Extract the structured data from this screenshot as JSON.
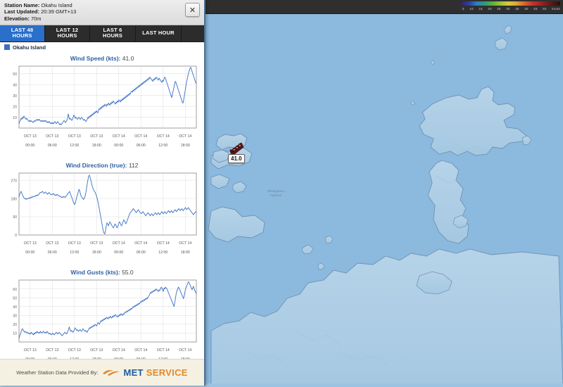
{
  "window": {
    "close_label": "✕"
  },
  "station": {
    "name_label": "Station Name:",
    "name_value": "Okahu Island",
    "updated_label": "Last Updated:",
    "updated_value": "20:39 GMT+13",
    "elevation_label": "Elevation:",
    "elevation_value": "70m"
  },
  "tabs": [
    {
      "label": "LAST 48 HOURS",
      "active": true
    },
    {
      "label": "LAST 12 HOURS",
      "active": false
    },
    {
      "label": "LAST 6 HOURS",
      "active": false
    },
    {
      "label": "LAST HOUR",
      "active": false
    }
  ],
  "legend": {
    "series_label": "Okahu Island",
    "series_color": "#3a6fc4"
  },
  "map": {
    "marker_value": "41.0",
    "marker_color": "#5e1414",
    "ocean_color": "#8cb9de",
    "land_color": "#aecee6",
    "scale_units": "knots",
    "scale_ticks": [
      "5",
      "10",
      "15",
      "20",
      "25",
      "30",
      "35",
      "40",
      "45",
      "50"
    ]
  },
  "footer": {
    "credit": "Weather Station Data Provided By:",
    "brand_first": "MET",
    "brand_second": "SERVICE",
    "brand_first_color": "#1c5c9e",
    "brand_second_color": "#e08a2e"
  },
  "chart_data": [
    {
      "type": "line",
      "title_main": "Wind Speed (kts):",
      "title_value": "41.0",
      "ylabel": "",
      "xlabel": "",
      "ylim": [
        0,
        57
      ],
      "yticks": [
        10,
        20,
        30,
        40,
        50
      ],
      "xticks": [
        {
          "date": "OCT 13",
          "time": "00:00"
        },
        {
          "date": "OCT 13",
          "time": "06:00"
        },
        {
          "date": "OCT 13",
          "time": "12:00"
        },
        {
          "date": "OCT 13",
          "time": "18:00"
        },
        {
          "date": "OCT 14",
          "time": "00:00"
        },
        {
          "date": "OCT 14",
          "time": "06:00"
        },
        {
          "date": "OCT 14",
          "time": "12:00"
        },
        {
          "date": "OCT 14",
          "time": "18:00"
        }
      ],
      "grid": true,
      "series_color": "#3a6fc4",
      "values": [
        4,
        6,
        7,
        9,
        8,
        10,
        9,
        11,
        10,
        9,
        8,
        9,
        8,
        7,
        6,
        7,
        6,
        7,
        6,
        6,
        5,
        6,
        7,
        6,
        7,
        8,
        7,
        8,
        7,
        8,
        7,
        6,
        7,
        6,
        7,
        6,
        7,
        6,
        7,
        6,
        5,
        6,
        5,
        6,
        5,
        4,
        5,
        4,
        5,
        4,
        5,
        6,
        5,
        4,
        5,
        6,
        5,
        4,
        3,
        4,
        3,
        4,
        5,
        6,
        7,
        6,
        5,
        6,
        7,
        9,
        13,
        10,
        8,
        9,
        8,
        7,
        8,
        10,
        12,
        11,
        9,
        10,
        9,
        8,
        9,
        10,
        9,
        8,
        9,
        10,
        9,
        8,
        7,
        8,
        7,
        6,
        7,
        8,
        10,
        9,
        11,
        10,
        12,
        11,
        13,
        12,
        14,
        13,
        15,
        14,
        16,
        15,
        14,
        16,
        18,
        17,
        19,
        18,
        20,
        19,
        21,
        20,
        22,
        21,
        20,
        22,
        21,
        23,
        22,
        21,
        23,
        22,
        24,
        23,
        25,
        24,
        23,
        22,
        24,
        23,
        25,
        24,
        26,
        25,
        24,
        26,
        25,
        27,
        26,
        28,
        27,
        29,
        28,
        30,
        29,
        31,
        30,
        32,
        31,
        33,
        34,
        33,
        35,
        34,
        36,
        35,
        37,
        36,
        38,
        37,
        39,
        38,
        40,
        39,
        41,
        40,
        42,
        41,
        43,
        42,
        44,
        43,
        45,
        44,
        46,
        45,
        47,
        46,
        45,
        44,
        43,
        45,
        44,
        46,
        45,
        47,
        46,
        45,
        44,
        46,
        45,
        44,
        43,
        42,
        44,
        43,
        45,
        47,
        46,
        44,
        42,
        40,
        38,
        36,
        34,
        32,
        30,
        28,
        31,
        34,
        37,
        40,
        43,
        42,
        40,
        38,
        36,
        34,
        32,
        30,
        28,
        26,
        24,
        23,
        26,
        30,
        34,
        38,
        42,
        45,
        48,
        51,
        53,
        55,
        56,
        54,
        52,
        50,
        48,
        46,
        44,
        42,
        41
      ]
    },
    {
      "type": "line",
      "title_main": "Wind Direction (true):",
      "title_value": "112",
      "ylabel": "",
      "xlabel": "",
      "ylim": [
        0,
        305
      ],
      "yticks": [
        0,
        90,
        180,
        270
      ],
      "xticks": [
        {
          "date": "OCT 13",
          "time": "00:00"
        },
        {
          "date": "OCT 13",
          "time": "06:00"
        },
        {
          "date": "OCT 13",
          "time": "12:00"
        },
        {
          "date": "OCT 13",
          "time": "18:00"
        },
        {
          "date": "OCT 14",
          "time": "00:00"
        },
        {
          "date": "OCT 14",
          "time": "06:00"
        },
        {
          "date": "OCT 14",
          "time": "12:00"
        },
        {
          "date": "OCT 14",
          "time": "18:00"
        }
      ],
      "grid": true,
      "series_color": "#3a6fc4",
      "values": [
        188,
        200,
        210,
        215,
        205,
        195,
        188,
        182,
        178,
        180,
        175,
        180,
        178,
        182,
        180,
        185,
        182,
        188,
        185,
        190,
        188,
        192,
        190,
        195,
        192,
        198,
        195,
        200,
        205,
        210,
        208,
        212,
        215,
        210,
        205,
        208,
        212,
        208,
        205,
        200,
        205,
        210,
        205,
        200,
        198,
        202,
        200,
        205,
        200,
        195,
        198,
        195,
        200,
        198,
        195,
        190,
        192,
        188,
        185,
        188,
        185,
        190,
        188,
        185,
        190,
        195,
        200,
        205,
        210,
        215,
        205,
        195,
        185,
        175,
        165,
        155,
        150,
        160,
        175,
        190,
        200,
        215,
        225,
        215,
        200,
        190,
        185,
        180,
        175,
        180,
        190,
        205,
        225,
        250,
        270,
        290,
        295,
        285,
        270,
        255,
        240,
        230,
        220,
        215,
        210,
        200,
        190,
        175,
        160,
        140,
        120,
        100,
        80,
        60,
        40,
        20,
        10,
        5,
        20,
        45,
        60,
        55,
        45,
        55,
        65,
        60,
        50,
        45,
        40,
        35,
        45,
        55,
        50,
        40,
        35,
        45,
        55,
        65,
        60,
        50,
        45,
        55,
        65,
        75,
        70,
        60,
        55,
        65,
        75,
        85,
        95,
        105,
        110,
        115,
        120,
        125,
        130,
        125,
        120,
        115,
        110,
        115,
        120,
        125,
        118,
        112,
        108,
        105,
        110,
        115,
        110,
        105,
        100,
        95,
        100,
        105,
        110,
        105,
        100,
        95,
        100,
        105,
        100,
        95,
        100,
        105,
        110,
        105,
        100,
        105,
        110,
        105,
        100,
        105,
        110,
        115,
        110,
        105,
        110,
        115,
        110,
        105,
        110,
        115,
        120,
        115,
        110,
        115,
        120,
        115,
        110,
        115,
        120,
        125,
        120,
        115,
        120,
        125,
        130,
        125,
        120,
        125,
        130,
        125,
        120,
        125,
        130,
        135,
        130,
        125,
        130,
        135,
        130,
        125,
        120,
        115,
        110,
        105,
        100,
        105,
        110,
        115,
        112
      ]
    },
    {
      "type": "line",
      "title_main": "Wind Gusts (kts):",
      "title_value": "55.0",
      "ylabel": "",
      "xlabel": "",
      "ylim": [
        0,
        70
      ],
      "yticks": [
        10,
        20,
        30,
        40,
        50,
        60
      ],
      "xticks": [
        {
          "date": "OCT 13",
          "time": "00:00"
        },
        {
          "date": "OCT 13",
          "time": "06:00"
        },
        {
          "date": "OCT 13",
          "time": "12:00"
        },
        {
          "date": "OCT 13",
          "time": "18:00"
        },
        {
          "date": "OCT 14",
          "time": "00:00"
        },
        {
          "date": "OCT 14",
          "time": "06:00"
        },
        {
          "date": "OCT 14",
          "time": "12:00"
        },
        {
          "date": "OCT 14",
          "time": "18:00"
        }
      ],
      "grid": true,
      "series_color": "#3a6fc4",
      "values": [
        4,
        7,
        9,
        12,
        14,
        15,
        13,
        12,
        11,
        12,
        11,
        10,
        11,
        10,
        9,
        10,
        9,
        11,
        10,
        9,
        8,
        10,
        9,
        11,
        10,
        12,
        11,
        10,
        11,
        10,
        12,
        11,
        10,
        11,
        12,
        11,
        10,
        11,
        10,
        12,
        11,
        10,
        9,
        10,
        9,
        8,
        9,
        10,
        9,
        8,
        9,
        10,
        11,
        10,
        9,
        10,
        11,
        10,
        9,
        8,
        7,
        8,
        9,
        10,
        11,
        10,
        9,
        10,
        12,
        14,
        17,
        14,
        12,
        13,
        12,
        11,
        12,
        14,
        16,
        15,
        13,
        14,
        13,
        12,
        13,
        14,
        13,
        12,
        13,
        15,
        14,
        13,
        12,
        13,
        12,
        11,
        13,
        14,
        16,
        15,
        17,
        16,
        18,
        17,
        19,
        18,
        20,
        19,
        18,
        20,
        22,
        21,
        20,
        22,
        24,
        23,
        25,
        24,
        26,
        25,
        27,
        26,
        28,
        27,
        26,
        28,
        27,
        29,
        28,
        27,
        29,
        28,
        30,
        29,
        31,
        30,
        29,
        28,
        30,
        29,
        31,
        30,
        32,
        31,
        30,
        32,
        31,
        33,
        34,
        33,
        35,
        34,
        36,
        35,
        37,
        36,
        38,
        37,
        39,
        40,
        39,
        41,
        40,
        42,
        41,
        43,
        42,
        44,
        43,
        45,
        46,
        45,
        47,
        46,
        48,
        47,
        49,
        48,
        50,
        49,
        51,
        52,
        54,
        56,
        55,
        57,
        56,
        58,
        57,
        59,
        58,
        60,
        59,
        58,
        57,
        59,
        58,
        60,
        62,
        61,
        59,
        57,
        61,
        60,
        62,
        61,
        60,
        58,
        56,
        54,
        52,
        50,
        48,
        46,
        44,
        42,
        40,
        45,
        50,
        55,
        58,
        60,
        62,
        61,
        59,
        57,
        55,
        53,
        51,
        49,
        52,
        56,
        60,
        62,
        64,
        66,
        68,
        67,
        65,
        63,
        61,
        59,
        61,
        63,
        60,
        58,
        56,
        55
      ]
    }
  ]
}
